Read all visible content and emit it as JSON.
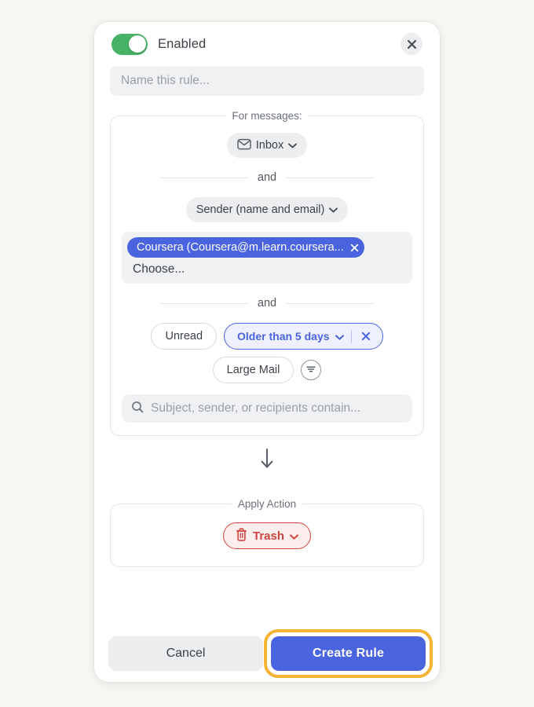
{
  "header": {
    "toggle_state": "on",
    "enabled_label": "Enabled",
    "close_icon": "close-icon"
  },
  "rule_name": {
    "value": "",
    "placeholder": "Name this rule..."
  },
  "conditions": {
    "legend": "For messages:",
    "mailbox_chip": {
      "icon": "envelope-icon",
      "label": "Inbox",
      "chevron": "chevron-down-icon"
    },
    "and_label_1": "and",
    "sender_chip": {
      "label": "Sender (name and email)",
      "chevron": "chevron-down-icon"
    },
    "sender_token": {
      "label": "Coursera (Coursera@m.learn.coursera...",
      "remove_icon": "close-icon"
    },
    "sender_choose_placeholder": "Choose...",
    "and_label_2": "and",
    "filters": [
      {
        "label": "Unread",
        "state": "unselected"
      },
      {
        "label": "Older than 5 days",
        "state": "selected",
        "chevron": "chevron-down-icon",
        "remove_icon": "close-icon"
      },
      {
        "label": "Large Mail",
        "state": "unselected"
      }
    ],
    "more_filters_icon": "filter-lines-icon",
    "search": {
      "icon": "search-icon",
      "value": "",
      "placeholder": "Subject, sender, or recipients contain..."
    }
  },
  "flow_arrow_icon": "arrow-down-icon",
  "action": {
    "legend": "Apply Action",
    "chip": {
      "icon": "trash-icon",
      "label": "Trash",
      "chevron": "chevron-down-icon"
    }
  },
  "footer": {
    "cancel_label": "Cancel",
    "create_label": "Create Rule"
  },
  "colors": {
    "page_background": "#f7f6f1",
    "card_background": "#ffffff",
    "toggle_on": "#47b264",
    "accent_blue": "#4a63de",
    "selected_chip_fill": "#eef1fd",
    "danger_red": "#cf443e",
    "danger_fill": "#fdeeee",
    "highlight_ring": "#f5b335",
    "field_fill": "#f0f1f3",
    "chip_fill": "#eceef0"
  }
}
